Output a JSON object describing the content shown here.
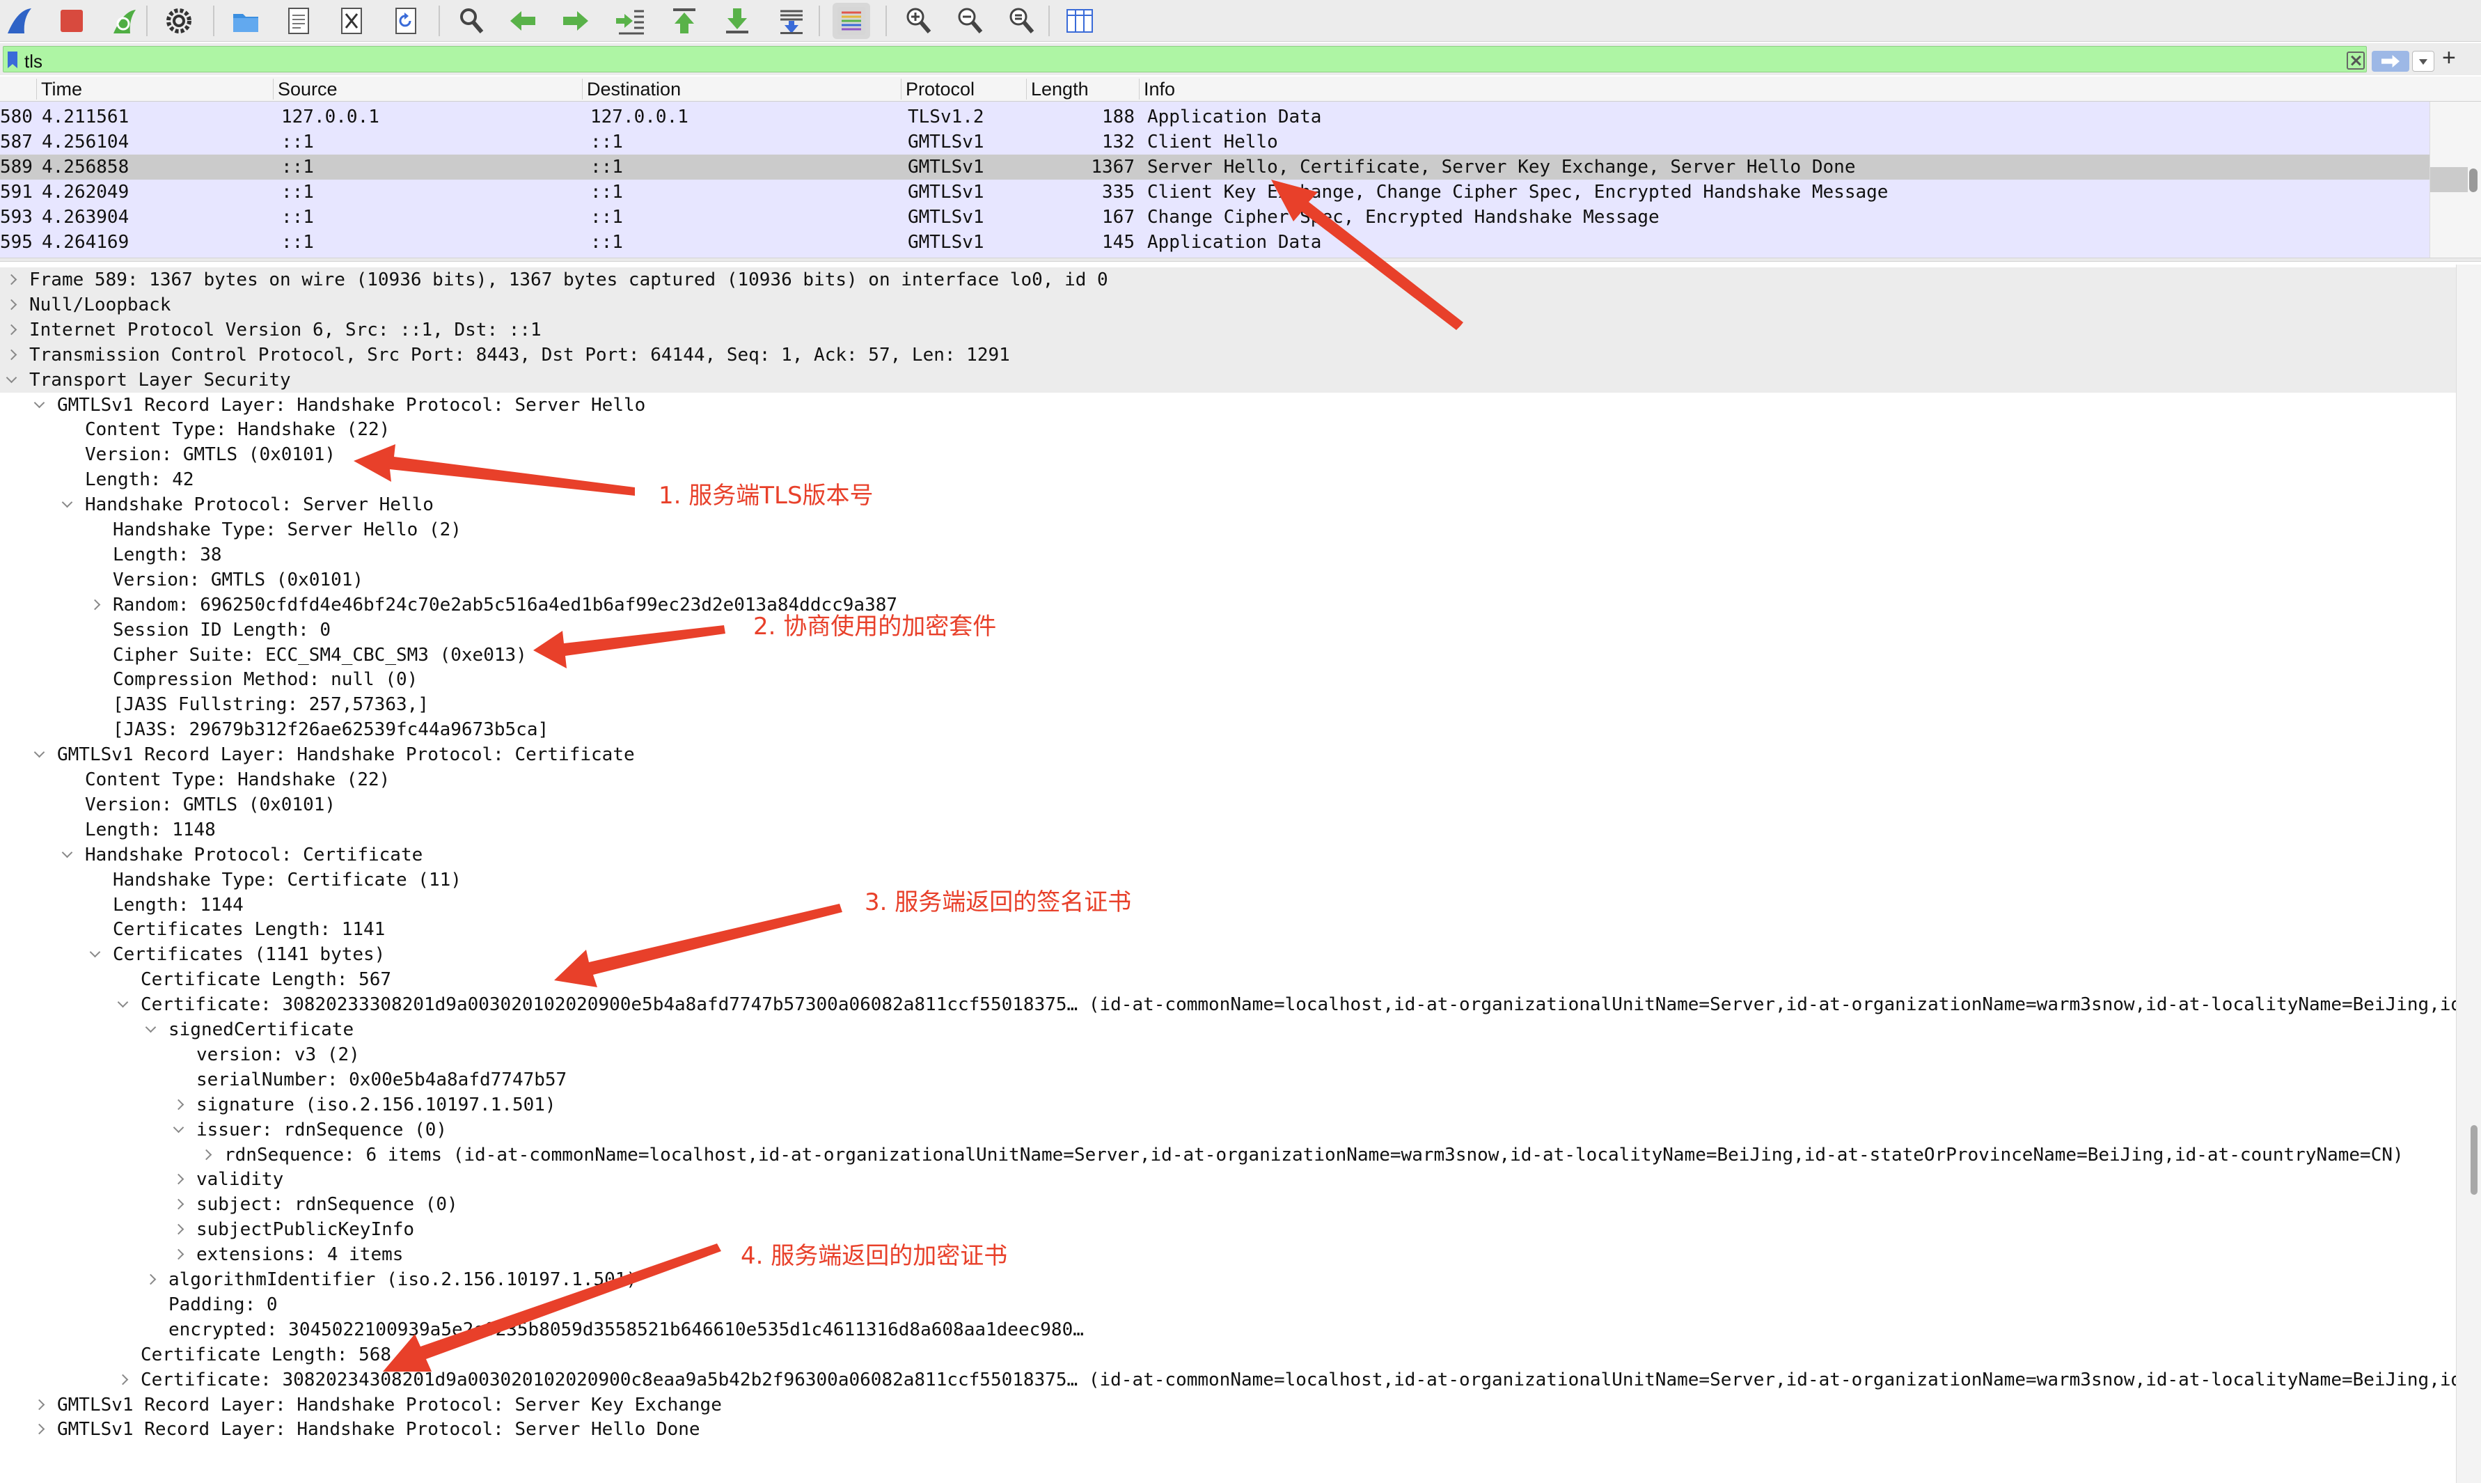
{
  "toolbar": {
    "buttons": [
      {
        "name": "start-capture-icon",
        "icon": "shark-fin"
      },
      {
        "name": "stop-capture-icon",
        "icon": "stop"
      },
      {
        "name": "restart-capture-icon",
        "icon": "restart"
      },
      {
        "name": "capture-options-icon",
        "icon": "gear"
      },
      {
        "name": "open-file-icon",
        "icon": "folder"
      },
      {
        "name": "save-file-icon",
        "icon": "document"
      },
      {
        "name": "close-file-icon",
        "icon": "close-document"
      },
      {
        "name": "reload-file-icon",
        "icon": "reload"
      },
      {
        "name": "find-packet-icon",
        "icon": "magnifier"
      },
      {
        "name": "go-back-icon",
        "icon": "arrow-left"
      },
      {
        "name": "go-forward-icon",
        "icon": "arrow-right"
      },
      {
        "name": "go-to-packet-icon",
        "icon": "arrow-right-lines"
      },
      {
        "name": "first-packet-icon",
        "icon": "arrow-up-bar"
      },
      {
        "name": "last-packet-icon",
        "icon": "arrow-down-bar"
      },
      {
        "name": "auto-scroll-icon",
        "icon": "arrow-down-lines"
      },
      {
        "name": "colorize-icon",
        "icon": "color-lines"
      },
      {
        "name": "zoom-in-icon",
        "icon": "zoom-in"
      },
      {
        "name": "zoom-out-icon",
        "icon": "zoom-out"
      },
      {
        "name": "normal-size-icon",
        "icon": "zoom-reset"
      },
      {
        "name": "resize-columns-icon",
        "icon": "columns"
      }
    ]
  },
  "filter": {
    "value": "tls"
  },
  "packet_list": {
    "columns": [
      "Time",
      "Source",
      "Destination",
      "Protocol",
      "Length",
      "Info"
    ],
    "rows": [
      {
        "no": "580",
        "time": "4.211561",
        "source": "127.0.0.1",
        "destination": "127.0.0.1",
        "protocol": "TLSv1.2",
        "length": "188",
        "info": "Application Data"
      },
      {
        "no": "587",
        "time": "4.256104",
        "source": "::1",
        "destination": "::1",
        "protocol": "GMTLSv1",
        "length": "132",
        "info": "Client Hello"
      },
      {
        "no": "589",
        "time": "4.256858",
        "source": "::1",
        "destination": "::1",
        "protocol": "GMTLSv1",
        "length": "1367",
        "info": "Server Hello, Certificate, Server Key Exchange, Server Hello Done",
        "selected": true
      },
      {
        "no": "591",
        "time": "4.262049",
        "source": "::1",
        "destination": "::1",
        "protocol": "GMTLSv1",
        "length": "335",
        "info": "Client Key Exchange, Change Cipher Spec, Encrypted Handshake Message"
      },
      {
        "no": "593",
        "time": "4.263904",
        "source": "::1",
        "destination": "::1",
        "protocol": "GMTLSv1",
        "length": "167",
        "info": "Change Cipher Spec, Encrypted Handshake Message"
      },
      {
        "no": "595",
        "time": "4.264169",
        "source": "::1",
        "destination": "::1",
        "protocol": "GMTLSv1",
        "length": "145",
        "info": "Application Data"
      }
    ]
  },
  "details": [
    {
      "depth": 0,
      "twisty": "collapsed",
      "text": "Frame 589: 1367 bytes on wire (10936 bits), 1367 bytes captured (10936 bits) on interface lo0, id 0",
      "shade": true
    },
    {
      "depth": 0,
      "twisty": "collapsed",
      "text": "Null/Loopback",
      "shade": true
    },
    {
      "depth": 0,
      "twisty": "collapsed",
      "text": "Internet Protocol Version 6, Src: ::1, Dst: ::1",
      "shade": true
    },
    {
      "depth": 0,
      "twisty": "collapsed",
      "text": "Transmission Control Protocol, Src Port: 8443, Dst Port: 64144, Seq: 1, Ack: 57, Len: 1291",
      "shade": true
    },
    {
      "depth": 0,
      "twisty": "expanded",
      "text": "Transport Layer Security",
      "shade": true
    },
    {
      "depth": 1,
      "twisty": "expanded",
      "text": "GMTLSv1 Record Layer: Handshake Protocol: Server Hello"
    },
    {
      "depth": 2,
      "twisty": "none",
      "text": "Content Type: Handshake (22)"
    },
    {
      "depth": 2,
      "twisty": "none",
      "text": "Version: GMTLS (0x0101)"
    },
    {
      "depth": 2,
      "twisty": "none",
      "text": "Length: 42"
    },
    {
      "depth": 2,
      "twisty": "expanded",
      "text": "Handshake Protocol: Server Hello"
    },
    {
      "depth": 3,
      "twisty": "none",
      "text": "Handshake Type: Server Hello (2)"
    },
    {
      "depth": 3,
      "twisty": "none",
      "text": "Length: 38"
    },
    {
      "depth": 3,
      "twisty": "none",
      "text": "Version: GMTLS (0x0101)"
    },
    {
      "depth": 3,
      "twisty": "collapsed",
      "text": "Random: 696250cfdfd4e46bf24c70e2ab5c516a4ed1b6af99ec23d2e013a84ddcc9a387"
    },
    {
      "depth": 3,
      "twisty": "none",
      "text": "Session ID Length: 0"
    },
    {
      "depth": 3,
      "twisty": "none",
      "text": "Cipher Suite: ECC_SM4_CBC_SM3 (0xe013)"
    },
    {
      "depth": 3,
      "twisty": "none",
      "text": "Compression Method: null (0)"
    },
    {
      "depth": 3,
      "twisty": "none",
      "text": "[JA3S Fullstring: 257,57363,]"
    },
    {
      "depth": 3,
      "twisty": "none",
      "text": "[JA3S: 29679b312f26ae62539fc44a9673b5ca]"
    },
    {
      "depth": 1,
      "twisty": "expanded",
      "text": "GMTLSv1 Record Layer: Handshake Protocol: Certificate"
    },
    {
      "depth": 2,
      "twisty": "none",
      "text": "Content Type: Handshake (22)"
    },
    {
      "depth": 2,
      "twisty": "none",
      "text": "Version: GMTLS (0x0101)"
    },
    {
      "depth": 2,
      "twisty": "none",
      "text": "Length: 1148"
    },
    {
      "depth": 2,
      "twisty": "expanded",
      "text": "Handshake Protocol: Certificate"
    },
    {
      "depth": 3,
      "twisty": "none",
      "text": "Handshake Type: Certificate (11)"
    },
    {
      "depth": 3,
      "twisty": "none",
      "text": "Length: 1144"
    },
    {
      "depth": 3,
      "twisty": "none",
      "text": "Certificates Length: 1141"
    },
    {
      "depth": 3,
      "twisty": "expanded",
      "text": "Certificates (1141 bytes)"
    },
    {
      "depth": 4,
      "twisty": "none",
      "text": "Certificate Length: 567"
    },
    {
      "depth": 4,
      "twisty": "expanded",
      "text": "Certificate: 30820233308201d9a003020102020900e5b4a8afd7747b57300a06082a811ccf55018375… (id-at-commonName=localhost,id-at-organizationalUnitName=Server,id-at-organizationName=warm3snow,id-at-localityName=BeiJing,id"
    },
    {
      "depth": 5,
      "twisty": "expanded",
      "text": "signedCertificate"
    },
    {
      "depth": 6,
      "twisty": "none",
      "text": "version: v3 (2)"
    },
    {
      "depth": 6,
      "twisty": "none",
      "text": "serialNumber: 0x00e5b4a8afd7747b57"
    },
    {
      "depth": 6,
      "twisty": "collapsed",
      "text": "signature (iso.2.156.10197.1.501)"
    },
    {
      "depth": 6,
      "twisty": "expanded",
      "text": "issuer: rdnSequence (0)"
    },
    {
      "depth": 7,
      "twisty": "collapsed",
      "text": "rdnSequence: 6 items (id-at-commonName=localhost,id-at-organizationalUnitName=Server,id-at-organizationName=warm3snow,id-at-localityName=BeiJing,id-at-stateOrProvinceName=BeiJing,id-at-countryName=CN)"
    },
    {
      "depth": 6,
      "twisty": "collapsed",
      "text": "validity"
    },
    {
      "depth": 6,
      "twisty": "collapsed",
      "text": "subject: rdnSequence (0)"
    },
    {
      "depth": 6,
      "twisty": "collapsed",
      "text": "subjectPublicKeyInfo"
    },
    {
      "depth": 6,
      "twisty": "collapsed",
      "text": "extensions: 4 items"
    },
    {
      "depth": 5,
      "twisty": "collapsed",
      "text": "algorithmIdentifier (iso.2.156.10197.1.501)"
    },
    {
      "depth": 5,
      "twisty": "none",
      "text": "Padding: 0"
    },
    {
      "depth": 5,
      "twisty": "none",
      "text": "encrypted: 3045022100939a5e2e0235b8059d3558521b646610e535d1c4611316d8a608aa1deec980…"
    },
    {
      "depth": 4,
      "twisty": "none",
      "text": "Certificate Length: 568"
    },
    {
      "depth": 4,
      "twisty": "collapsed",
      "text": "Certificate: 30820234308201d9a003020102020900c8eaa9a5b42b2f96300a06082a811ccf55018375… (id-at-commonName=localhost,id-at-organizationalUnitName=Server,id-at-organizationName=warm3snow,id-at-localityName=BeiJing,id"
    },
    {
      "depth": 1,
      "twisty": "collapsed",
      "text": "GMTLSv1 Record Layer: Handshake Protocol: Server Key Exchange"
    },
    {
      "depth": 1,
      "twisty": "collapsed",
      "text": "GMTLSv1 Record Layer: Handshake Protocol: Server Hello Done"
    }
  ],
  "annotations": [
    {
      "label": "1. 服务端TLS版本号",
      "color": "#e8402a"
    },
    {
      "label": "2. 协商使用的加密套件",
      "color": "#e8402a"
    },
    {
      "label": "3. 服务端返回的签名证书",
      "color": "#e8402a"
    },
    {
      "label": "4. 服务端返回的加密证书",
      "color": "#e8402a"
    }
  ],
  "colors": {
    "filter_bg": "#aef5a4",
    "packet_row_bg": "#e7e6ff",
    "selected_row_bg": "#cbcbcb",
    "annotation": "#e8402a"
  }
}
